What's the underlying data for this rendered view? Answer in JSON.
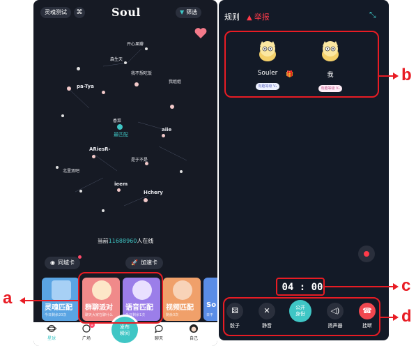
{
  "left_screen": {
    "top_bar": {
      "test_chip": "灵魂测试",
      "shuffle_glyph": "⌘",
      "brand": "Soul",
      "filter_label": "筛选",
      "filter_icon": "filter-icon"
    },
    "planet_labels": [
      {
        "text": "开心果瓣",
        "big": false
      },
      {
        "text": "森生天",
        "big": false
      },
      {
        "text": "我不想吃饭",
        "big": false
      },
      {
        "text": "我姐姐",
        "big": false
      },
      {
        "text": "pa-Tya",
        "big": true
      },
      {
        "text": "香菜",
        "big": false
      },
      {
        "text": "aiie",
        "big": true
      },
      {
        "text": "ARiesR-",
        "big": true
      },
      {
        "text": "是于不是",
        "big": false
      },
      {
        "text": "北里双吧",
        "big": false
      },
      {
        "text": "ieem",
        "big": true
      },
      {
        "text": "Hchery",
        "big": true
      }
    ],
    "match_me": "最匹配",
    "online": {
      "prefix": "当前",
      "count": "11688960",
      "suffix": "人在线"
    },
    "city_card": "同城卡",
    "speed_card": "加速卡",
    "cards": [
      {
        "title": "灵魂匹配",
        "sub": "今日剩余20次",
        "color": "#5aa4e3"
      },
      {
        "title": "群聊派对",
        "sub": "聊天大家在聊什么",
        "color": "#f08a8a"
      },
      {
        "title": "语音匹配",
        "sub": "今日剩余1次",
        "color": "#9b7ee9"
      },
      {
        "title": "视频匹配",
        "sub": "剩余3次",
        "color": "#f0a06a"
      },
      {
        "title": "So",
        "sub": "日不",
        "color": "#5a8de6"
      }
    ],
    "nav": {
      "planet": "星球",
      "square": "广场",
      "square_badge": "1",
      "publish": "发布\n瞬间",
      "chat": "聊天",
      "me": "自己"
    }
  },
  "right_screen": {
    "rules": "规则",
    "report": "举报",
    "users": [
      {
        "name": "Souler",
        "level": "有趣等级 V₂",
        "tag_color": "blue"
      },
      {
        "name": "我",
        "level": "有趣等级 V₂",
        "tag_color": "pink"
      }
    ],
    "timer": "04 : 00",
    "controls": {
      "dice": "骰子",
      "mute": "静音",
      "public": "公开\n身份",
      "speaker": "扬声器",
      "hangup": "挂断"
    }
  },
  "annotations": {
    "a": "a",
    "b": "b",
    "c": "c",
    "d": "d"
  },
  "colors": {
    "accent": "#3fc6c5",
    "annotation_red": "#e81c24",
    "hangup": "#f0474f"
  }
}
